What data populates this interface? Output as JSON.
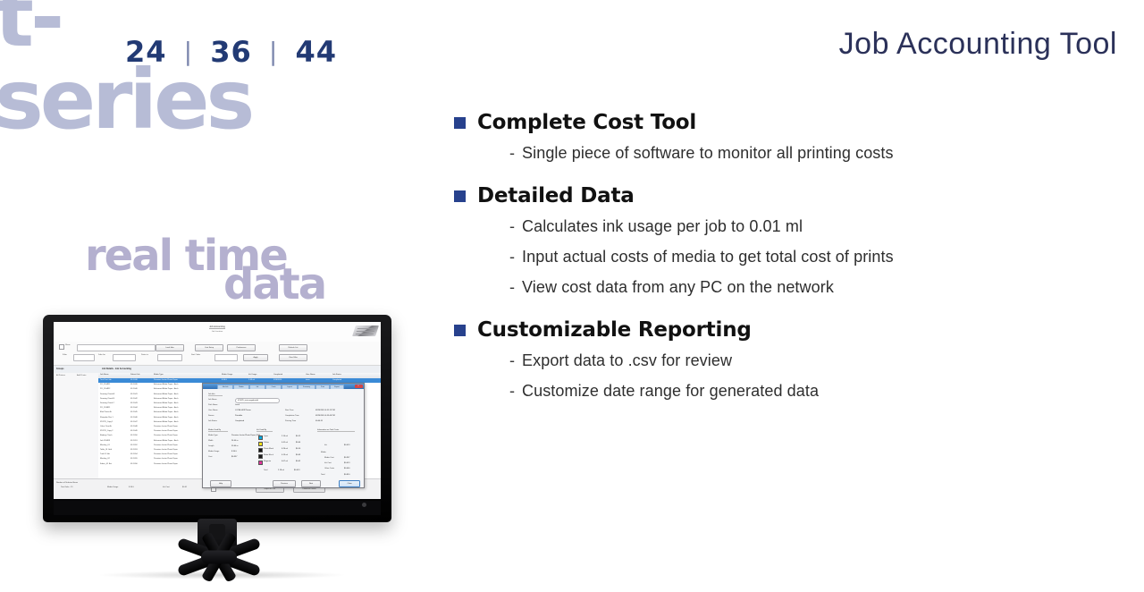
{
  "brand": {
    "word": "t-series",
    "sizes": [
      "24",
      "36",
      "44"
    ],
    "separator": "|"
  },
  "headline": "Job Accounting Tool",
  "decor": {
    "line1": "real time",
    "line2": "data"
  },
  "content": {
    "sections": [
      {
        "title": "Complete Cost Tool",
        "items": [
          "Single piece of software to monitor all printing costs"
        ]
      },
      {
        "title": "Detailed Data",
        "items": [
          "Calculates ink usage per job to 0.01 ml",
          "Input actual costs of media to get total cost of prints",
          "View cost data from any PC on the network"
        ]
      },
      {
        "title": "Customizable Reporting",
        "items": [
          "Export data to .csv for review",
          "Customize date range for generated data"
        ]
      }
    ],
    "dash": "-"
  },
  "colors": {
    "brand_light": "#b7bcd6",
    "brand_navy": "#223a74",
    "headline": "#2b3159",
    "bullet_square": "#27418d",
    "decor": "#b4b0cf",
    "body_text": "#2e2e2e"
  },
  "monitor_app": {
    "title_main": "Job Accounting",
    "title_sub": "Job Location",
    "title_sub2": "Unknown Jobs Info",
    "toolbar": {
      "row1": {
        "checkbox_label": "Show",
        "path_value": "C:\\Users\\Public\\Documents\\JobAccounting",
        "buttons": [
          "Load Jobs",
          "Cost Setup",
          "Preferences",
          "Refresh List"
        ]
      },
      "row2": {
        "filter_label": "Filter",
        "filter_value": "Month",
        "date_label": "Jobs for",
        "date_value": "Dates in",
        "sort_label": "Sort Order",
        "buttons": [
          "Apply",
          "Clear Filter"
        ]
      }
    },
    "pane_headers": [
      "Groups",
      "Job Details - Job Accounting"
    ],
    "left_pane": [
      "All Printers",
      "Add Printer"
    ],
    "grid": {
      "columns": [
        "Job Name",
        "Submit Job",
        "Media Type",
        "Media Usage",
        "Ink Usage",
        "Completed",
        "User Name",
        "Job Status"
      ],
      "rows": [
        {
          "cells": [
            "Test Print Job",
            "02-1038",
            "Premium Luster Photo Paper",
            "8.30 ft",
            "2.43 ml",
            "3/26/2014",
            "tuser",
            "Completed"
          ],
          "selected": true
        },
        {
          "cells": [
            "PO_1104R1",
            "02-1039",
            "Enhanced Matte Paper - Arch.",
            "6.41 ft",
            "3.41 ml",
            "3/26/2014",
            "tuser",
            "Completed"
          ],
          "selected": false
        },
        {
          "cells": [
            "PO_1104R2",
            "02-1040",
            "Enhanced Matte Paper - Arch.",
            "6.41 ft",
            "3.41 ml",
            "3/26/2014",
            "tuser",
            "Completed"
          ],
          "selected": false
        },
        {
          "cells": [
            "Drawing Check A",
            "02-1041",
            "Enhanced Matte Paper - Arch.",
            "5.92 ft",
            "2.96 ml",
            "3/26/2014",
            "Tmiller",
            "Completed"
          ],
          "selected": false
        },
        {
          "cells": [
            "Drawing Check B",
            "02-1042",
            "Enhanced Matte Paper - Arch.",
            "5.92 ft",
            "2.96 ml",
            "3/26/2014",
            "Tmiller",
            "Completed"
          ],
          "selected": false
        },
        {
          "cells": [
            "Drawing Check C",
            "02-1043",
            "Enhanced Matte Paper - Arch.",
            "5.92 ft",
            "2.96 ml",
            "3/26/2014",
            "Tmiller",
            "Completed"
          ],
          "selected": false
        },
        {
          "cells": [
            "PO_1108R1",
            "02-1044",
            "Enhanced Matte Paper - Arch.",
            "9.14 ft",
            "1.88 ml",
            "3/26/2014",
            "tuser",
            "Completed"
          ],
          "selected": false
        },
        {
          "cells": [
            "Elev Poster A",
            "02-1045",
            "Enhanced Matte Paper - Arch.",
            "2.21 ft",
            "1.01 ml",
            "3/26/2014",
            "tuser",
            "Completed"
          ],
          "selected": false
        },
        {
          "cells": [
            "Floorplan Rev 1",
            "02-1046",
            "Enhanced Matte Paper - Arch.",
            "3.56 ft",
            "1.12 ml",
            "3/26/2014",
            "tuser",
            "Completed"
          ],
          "selected": false
        },
        {
          "cells": [
            "NY17R_Copy 1",
            "02-1047",
            "Enhanced Matte Paper - Arch.",
            "3.56 ft",
            "1.12 ml",
            "3/26/2014",
            "tuser",
            "Completed"
          ],
          "selected": false
        },
        {
          "cells": [
            "Color Chart A",
            "02-1048",
            "Premium Luster Photo Paper",
            "3.56 ft",
            "4.14 ml",
            "3/26/2014",
            "tuser",
            "Completed"
          ],
          "selected": false
        },
        {
          "cells": [
            "NY17R_Copy 2",
            "02-1049",
            "Premium Luster Photo Paper",
            "3.56 ft",
            "1.12 ml",
            "3/26/2014",
            "tuser",
            "Completed"
          ],
          "selected": false
        },
        {
          "cells": [
            "Bindery Check",
            "02-1050",
            "Premium Luster Photo Paper",
            "3.21 ft",
            "3.12 ml",
            "3/26/2014",
            "tuser",
            "Completed"
          ],
          "selected": false
        },
        {
          "cells": [
            "Job 1104R3",
            "02-1051",
            "Enhanced Matte Paper - Arch.",
            "3.36 ft",
            "1.18 ml",
            "3/26/2014",
            "tuser",
            "Completed"
          ],
          "selected": false
        },
        {
          "cells": [
            "Mockup_01",
            "02-1052",
            "Premium Luster Photo Paper",
            "1.18 ft",
            "1.18 ml",
            "3/26/2014",
            "tuser",
            "Completed"
          ],
          "selected": false
        },
        {
          "cells": [
            "Table_01 Grid",
            "02-1053",
            "Premium Luster Photo Paper",
            "1.18 ft",
            "1.18 ml",
            "3/26/2014",
            "tuser",
            "Completed"
          ],
          "selected": false
        },
        {
          "cells": [
            "Trial 01 Job",
            "02-1054",
            "Premium Luster Photo Paper",
            "1.18 ft",
            "1.18 ml",
            "3/26/2014",
            "tuser",
            "Completed"
          ],
          "selected": false
        },
        {
          "cells": [
            "Mockup_02",
            "02-1055",
            "Premium Luster Photo Paper",
            "1.18 ft",
            "1.18 ml",
            "3/26/2014",
            "tuser",
            "Completed"
          ],
          "selected": false
        },
        {
          "cells": [
            "Fabric_01 Ext",
            "02-1056",
            "Premium Luster Photo Paper",
            "1.44 ft",
            "1.18 ml",
            "3/26/2014",
            "tuser",
            "Completed"
          ],
          "selected": false
        }
      ]
    },
    "status_bar": {
      "labels": [
        "Number of Selected Items",
        "Media Usage",
        "Ink Cost",
        "Show All Costs"
      ],
      "values": [
        "Total Jobs : 19",
        "8.30 ft",
        "$0.41"
      ],
      "buttons": [
        "Export to CSV",
        "Database Details"
      ]
    },
    "dialog": {
      "tabs": [
        "Job Info",
        "Media",
        "Ink",
        "Costs",
        "Layout",
        "Summary",
        "Print",
        "Export",
        "Options"
      ],
      "close": "X",
      "section_job": "Job Info",
      "fields_left": [
        {
          "label": "Job Name",
          "value": "070879_test-copyjob.indd"
        },
        {
          "label": "Path Name",
          "value": "Local"
        },
        {
          "label": "User Name",
          "value": "LOCALHOST\\tuser"
        },
        {
          "label": "Source",
          "value": "Printable"
        },
        {
          "label": "Job Status",
          "value": "Completed"
        }
      ],
      "fields_right": [
        {
          "label": "Start Time",
          "value": "03/26/2014 4:31:12 PM"
        },
        {
          "label": "Completion Time",
          "value": "03/26/2014 4:35:44 PM"
        },
        {
          "label": "Printing Time",
          "value": "00:04:31"
        }
      ],
      "section_media": "Media Used By",
      "media": [
        {
          "label": "Media Type",
          "value": "Premium Luster Photo Paper (260)"
        },
        {
          "label": "Width",
          "value": "24.00 in"
        },
        {
          "label": "Length",
          "value": "99.60 in"
        },
        {
          "label": "Media Usage",
          "value": "8.30 ft"
        },
        {
          "label": "Cost",
          "value": "$0.397"
        }
      ],
      "section_ink": "Ink Used By",
      "ink_table": {
        "columns": [
          "Color",
          "Usage",
          "Cost"
        ],
        "rows": [
          {
            "color_name": "Cyan",
            "hex": "#0aa7dd",
            "usage": "2.10 ml",
            "cost": "$0.12"
          },
          {
            "color_name": "Yellow",
            "hex": "#f4e11a",
            "usage": "0.41 ml",
            "cost": "$0.04"
          },
          {
            "color_name": "Photo Black",
            "hex": "#111111",
            "usage": "0.26 ml",
            "cost": "$0.10"
          },
          {
            "color_name": "Matte Black",
            "hex": "#1a1a1a",
            "usage": "0.13 ml",
            "cost": "$0.03"
          },
          {
            "color_name": "Magenta",
            "hex": "#e0359b",
            "usage": "0.07 ml",
            "cost": "$0.02"
          }
        ],
        "total_row": {
          "label": "Total",
          "usage": "2.18 ml",
          "cost": "$0.413"
        }
      },
      "section_summary": "Information on Total Costs",
      "summary": [
        {
          "label": "Ink",
          "value": "$0.413"
        },
        {
          "label": "Media",
          "value": ""
        },
        {
          "label": "Media Cost",
          "value": "$0.397"
        },
        {
          "label": "Ink Cost",
          "value": "$0.413"
        },
        {
          "label": "Other Costs",
          "value": "$0.000"
        },
        {
          "label": "Total",
          "value": "$0.810"
        }
      ],
      "buttons": [
        "Help",
        "Previous",
        "Next",
        "Close"
      ]
    }
  }
}
